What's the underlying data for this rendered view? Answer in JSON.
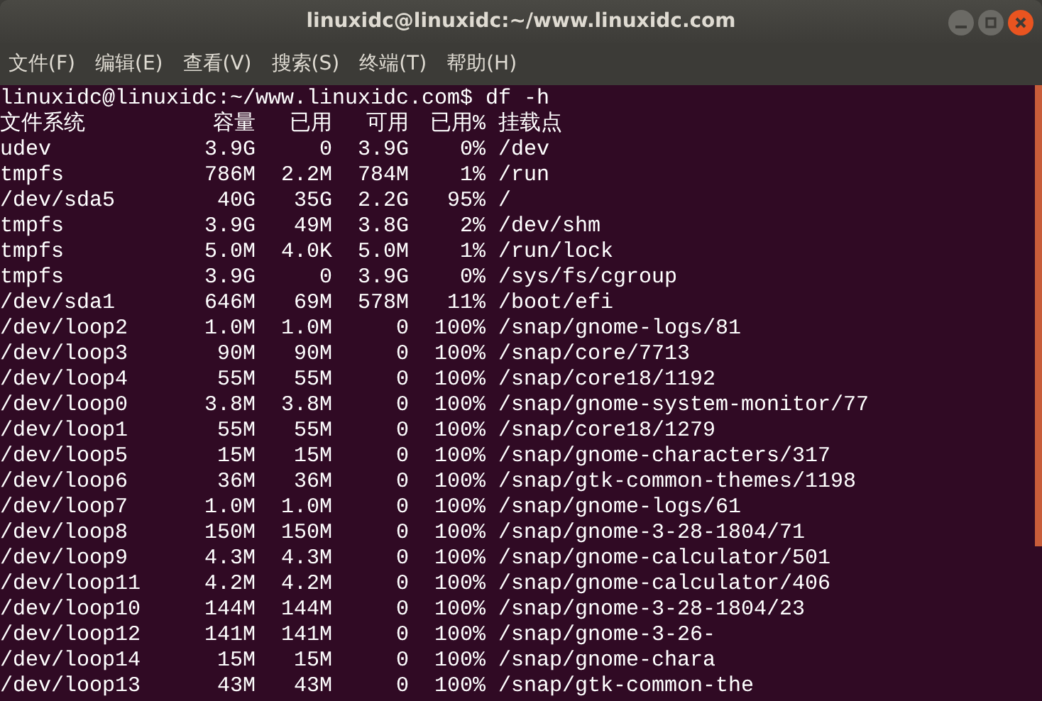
{
  "window": {
    "title": "linuxidc@linuxidc:~/www.linuxidc.com"
  },
  "menu": [
    "文件(F)",
    "编辑(E)",
    "查看(V)",
    "搜索(S)",
    "终端(T)",
    "帮助(H)"
  ],
  "terminal": {
    "prompt": "linuxidc@linuxidc:~/www.linuxidc.com$ df -h",
    "header": [
      "文件系统",
      "容量",
      "已用",
      "可用",
      "已用%",
      "挂载点"
    ],
    "rows": [
      [
        "udev",
        "3.9G",
        "0",
        "3.9G",
        "0%",
        "/dev"
      ],
      [
        "tmpfs",
        "786M",
        "2.2M",
        "784M",
        "1%",
        "/run"
      ],
      [
        "/dev/sda5",
        "40G",
        "35G",
        "2.2G",
        "95%",
        "/"
      ],
      [
        "tmpfs",
        "3.9G",
        "49M",
        "3.8G",
        "2%",
        "/dev/shm"
      ],
      [
        "tmpfs",
        "5.0M",
        "4.0K",
        "5.0M",
        "1%",
        "/run/lock"
      ],
      [
        "tmpfs",
        "3.9G",
        "0",
        "3.9G",
        "0%",
        "/sys/fs/cgroup"
      ],
      [
        "/dev/sda1",
        "646M",
        "69M",
        "578M",
        "11%",
        "/boot/efi"
      ],
      [
        "/dev/loop2",
        "1.0M",
        "1.0M",
        "0",
        "100%",
        "/snap/gnome-logs/81"
      ],
      [
        "/dev/loop3",
        "90M",
        "90M",
        "0",
        "100%",
        "/snap/core/7713"
      ],
      [
        "/dev/loop4",
        "55M",
        "55M",
        "0",
        "100%",
        "/snap/core18/1192"
      ],
      [
        "/dev/loop0",
        "3.8M",
        "3.8M",
        "0",
        "100%",
        "/snap/gnome-system-monitor/77"
      ],
      [
        "/dev/loop1",
        "55M",
        "55M",
        "0",
        "100%",
        "/snap/core18/1279"
      ],
      [
        "/dev/loop5",
        "15M",
        "15M",
        "0",
        "100%",
        "/snap/gnome-characters/317"
      ],
      [
        "/dev/loop6",
        "36M",
        "36M",
        "0",
        "100%",
        "/snap/gtk-common-themes/1198"
      ],
      [
        "/dev/loop7",
        "1.0M",
        "1.0M",
        "0",
        "100%",
        "/snap/gnome-logs/61"
      ],
      [
        "/dev/loop8",
        "150M",
        "150M",
        "0",
        "100%",
        "/snap/gnome-3-28-1804/71"
      ],
      [
        "/dev/loop9",
        "4.3M",
        "4.3M",
        "0",
        "100%",
        "/snap/gnome-calculator/501"
      ],
      [
        "/dev/loop11",
        "4.2M",
        "4.2M",
        "0",
        "100%",
        "/snap/gnome-calculator/406"
      ],
      [
        "/dev/loop10",
        "144M",
        "144M",
        "0",
        "100%",
        "/snap/gnome-3-28-1804/23"
      ],
      [
        "/dev/loop12",
        "141M",
        "141M",
        "0",
        "100%",
        "/snap/gnome-3-26-"
      ],
      [
        "/dev/loop14",
        "15M",
        "15M",
        "0",
        "100%",
        "/snap/gnome-chara"
      ],
      [
        "/dev/loop13",
        "43M",
        "43M",
        "0",
        "100%",
        "/snap/gtk-common-the"
      ]
    ]
  }
}
